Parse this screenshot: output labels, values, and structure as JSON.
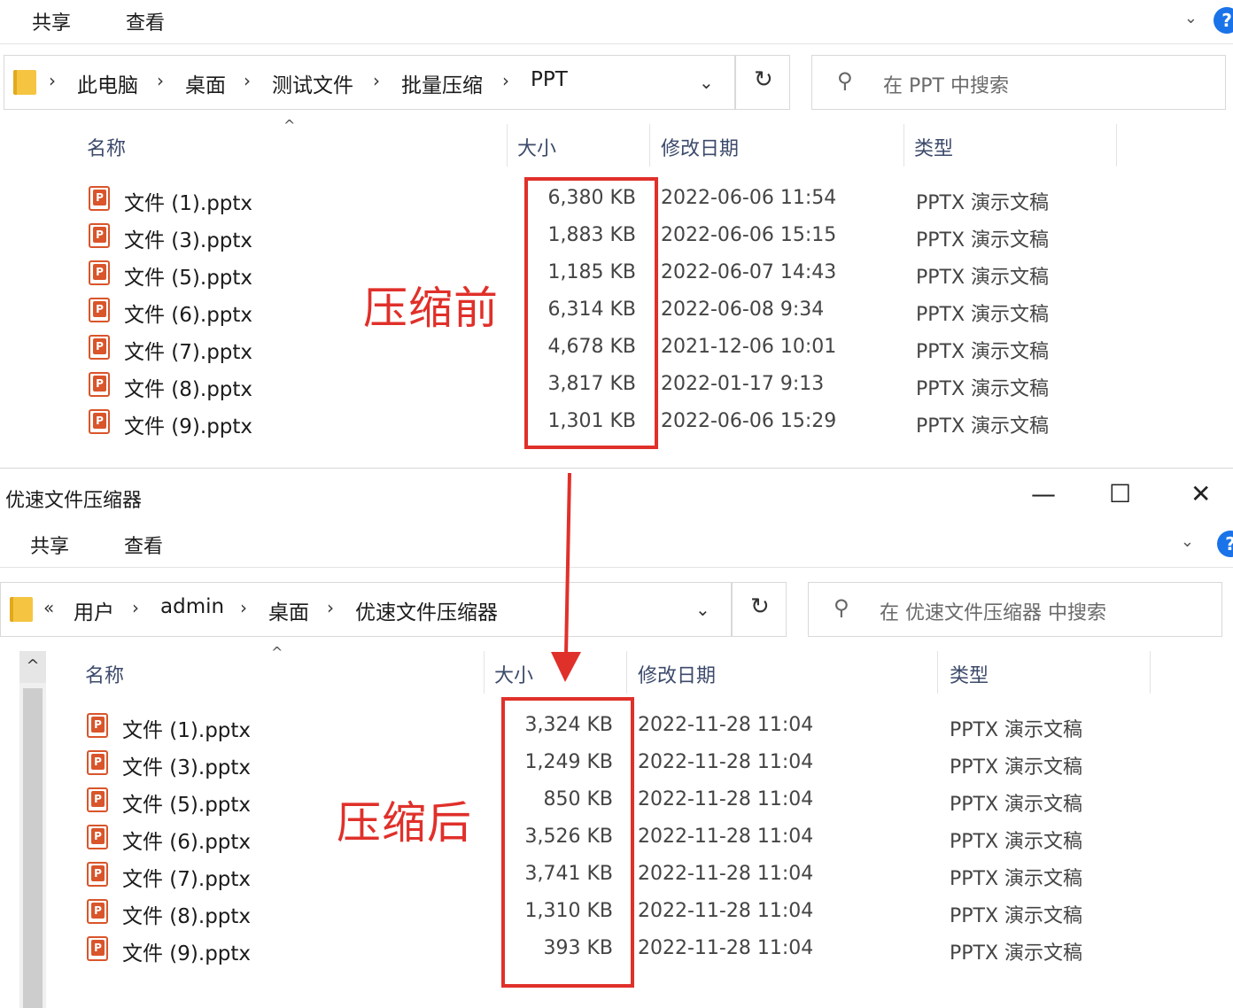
{
  "top_window": {
    "ribbon": {
      "share": "共享",
      "view": "查看",
      "expand_icon": "chevron-down-icon",
      "help": "?"
    },
    "address": {
      "segments": [
        "此电脑",
        "桌面",
        "测试文件",
        "批量压缩",
        "PPT"
      ]
    },
    "search_placeholder": "在 PPT 中搜索",
    "columns": {
      "name": "名称",
      "size": "大小",
      "date": "修改日期",
      "type": "类型"
    },
    "files": [
      {
        "name": "文件 (1).pptx",
        "size": "6,380 KB",
        "date": "2022-06-06 11:54",
        "type": "PPTX 演示文稿"
      },
      {
        "name": "文件 (3).pptx",
        "size": "1,883 KB",
        "date": "2022-06-06 15:15",
        "type": "PPTX 演示文稿"
      },
      {
        "name": "文件 (5).pptx",
        "size": "1,185 KB",
        "date": "2022-06-07 14:43",
        "type": "PPTX 演示文稿"
      },
      {
        "name": "文件 (6).pptx",
        "size": "6,314 KB",
        "date": "2022-06-08 9:34",
        "type": "PPTX 演示文稿"
      },
      {
        "name": "文件 (7).pptx",
        "size": "4,678 KB",
        "date": "2021-12-06 10:01",
        "type": "PPTX 演示文稿"
      },
      {
        "name": "文件 (8).pptx",
        "size": "3,817 KB",
        "date": "2022-01-17 9:13",
        "type": "PPTX 演示文稿"
      },
      {
        "name": "文件 (9).pptx",
        "size": "1,301 KB",
        "date": "2022-06-06 15:29",
        "type": "PPTX 演示文稿"
      }
    ],
    "annotation": "压缩前"
  },
  "bottom_window": {
    "title": "优速文件压缩器",
    "controls": {
      "minimize": "—",
      "maximize": "☐",
      "close": "✕"
    },
    "ribbon": {
      "share": "共享",
      "view": "查看",
      "help": "?"
    },
    "address": {
      "overflow": "«",
      "segments": [
        "用户",
        "admin",
        "桌面",
        "优速文件压缩器"
      ]
    },
    "search_placeholder": "在 优速文件压缩器 中搜索",
    "columns": {
      "name": "名称",
      "size": "大小",
      "date": "修改日期",
      "type": "类型"
    },
    "files": [
      {
        "name": "文件 (1).pptx",
        "size": "3,324 KB",
        "date": "2022-11-28 11:04",
        "type": "PPTX 演示文稿"
      },
      {
        "name": "文件 (3).pptx",
        "size": "1,249 KB",
        "date": "2022-11-28 11:04",
        "type": "PPTX 演示文稿"
      },
      {
        "name": "文件 (5).pptx",
        "size": "850 KB",
        "date": "2022-11-28 11:04",
        "type": "PPTX 演示文稿"
      },
      {
        "name": "文件 (6).pptx",
        "size": "3,526 KB",
        "date": "2022-11-28 11:04",
        "type": "PPTX 演示文稿"
      },
      {
        "name": "文件 (7).pptx",
        "size": "3,741 KB",
        "date": "2022-11-28 11:04",
        "type": "PPTX 演示文稿"
      },
      {
        "name": "文件 (8).pptx",
        "size": "1,310 KB",
        "date": "2022-11-28 11:04",
        "type": "PPTX 演示文稿"
      },
      {
        "name": "文件 (9).pptx",
        "size": "393 KB",
        "date": "2022-11-28 11:04",
        "type": "PPTX 演示文稿"
      }
    ],
    "annotation": "压缩后"
  },
  "colors": {
    "highlight": "#e0302a",
    "folder": "#f5c542",
    "ppt_icon": "#d9552b",
    "help": "#1a73e8"
  }
}
